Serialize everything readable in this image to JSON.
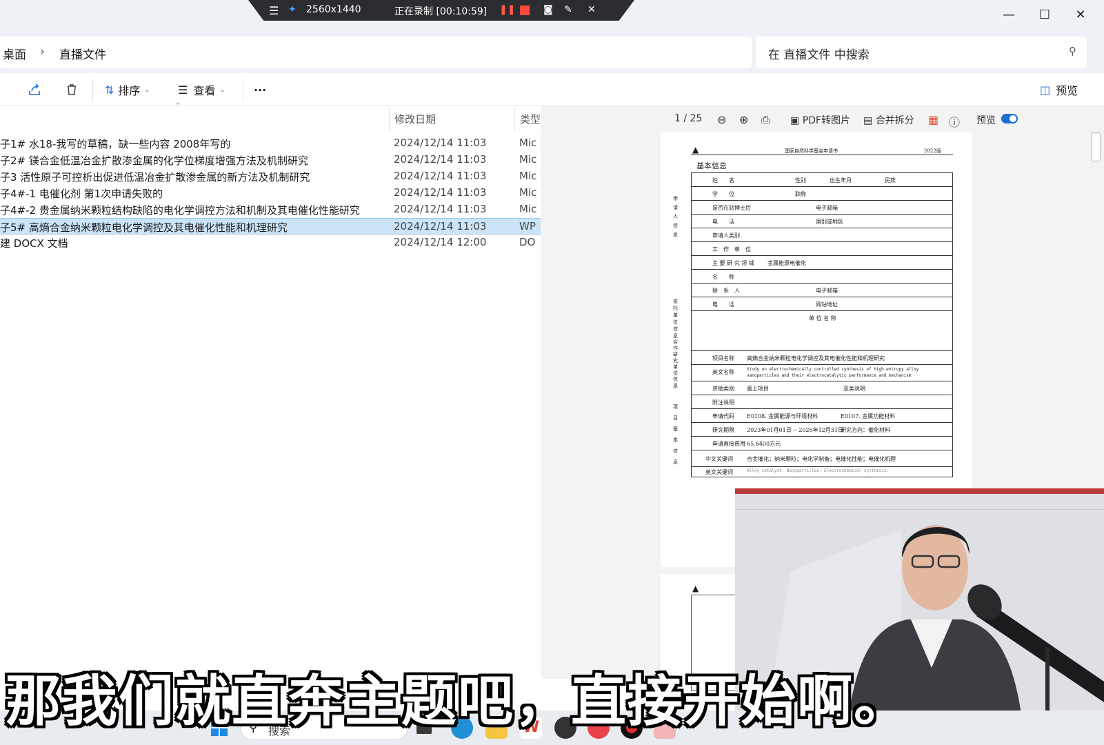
{
  "recorder": {
    "resolution": "2560x1440",
    "status": "正在录制 [00:10:59]"
  },
  "address": {
    "crumbs": [
      "桌面",
      "直播文件"
    ],
    "search_placeholder": "在 直播文件 中搜索"
  },
  "toolbar": {
    "sort_label": "排序",
    "view_label": "查看",
    "more_label": "···",
    "preview_label": "预览"
  },
  "filelist": {
    "columns": {
      "modified": "修改日期",
      "type": "类型"
    },
    "rows": [
      {
        "name": "子1# 水18-我写的草稿，缺一些内容 2008年写的",
        "date": "2024/12/14 11:03",
        "type": "Mic"
      },
      {
        "name": "子2# 镁合金低温冶金扩散渗金属的化学位梯度增强方法及机制研究",
        "date": "2024/12/14 11:03",
        "type": "Mic"
      },
      {
        "name": "子3 活性原子可控析出促进低温冶金扩散渗金属的新方法及机制研究",
        "date": "2024/12/14 11:03",
        "type": "Mic"
      },
      {
        "name": "子4#-1 电催化剂 第1次申请失败的",
        "date": "2024/12/14 11:03",
        "type": "Mic"
      },
      {
        "name": "子4#-2 贵金属纳米颗粒结构缺陷的电化学调控方法和机制及其电催化性能研究",
        "date": "2024/12/14 11:03",
        "type": "Mic"
      },
      {
        "name": "子5# 高熵合金纳米颗粒电化学调控及其电催化性能和机理研究",
        "date": "2024/12/14 11:03",
        "type": "WP"
      },
      {
        "name": "建 DOCX 文档",
        "date": "2024/12/14 12:00",
        "type": "DO"
      }
    ]
  },
  "preview": {
    "page_indicator": "1 / 25",
    "pdf_to_image": "PDF转图片",
    "merge_split": "合并拆分",
    "preview_toggle_label": "预览",
    "doc": {
      "header_center": "国家自然科学基金申请书",
      "header_right": "2022版",
      "section_title": "基本信息",
      "rows": [
        "姓　　名",
        "学　　位",
        "是否在站博士后",
        "电　　话",
        "申请人类别",
        "工　作　单　位",
        "主 要 研 究 领 域",
        "名　　称",
        "联　系　人",
        "电　　话",
        "单 位 名 称",
        "项目名称",
        "英文名称",
        "资助类别",
        "附注说明",
        "申请代码",
        "研究期限",
        "申请直接费用",
        "中文关键词",
        "英文关键词"
      ],
      "cells": {
        "gender": "性别",
        "birth": "出生年月",
        "nation": "民族",
        "title": "职称",
        "email": "电子邮箱",
        "country": "国别或地区",
        "field_value": "金属能源电催化",
        "email2": "电子邮箱",
        "website": "网站地址",
        "project_name": "高熵合金纳米颗粒电化学调控及其电催化性能和机理研究",
        "english_name": "Study on electrochemically controlled synthesis of high-entropy alloy nanoparticles and their electrocatalytic performance and mechanism",
        "funding_type": "面上项目",
        "sub_type": "亚类说明",
        "code1": "E0108. 金属能源与环境材料",
        "code2": "E0107. 金属功能材料",
        "period": "2023年01月01日 -- 2026年12月31日",
        "direction": "研究方向：催化材料",
        "cost": "65.6400万元",
        "cn_keywords": "合金催化；纳米颗粒；电化学制备；电催化性能；电催化机理",
        "en_keywords": "Alloy catalyst; Nanoparticles; Electrochemical synthesis;"
      },
      "side_groups": [
        "申请人信息",
        "依托单位信息",
        "合作研究单位信息",
        "项目基本信息"
      ]
    }
  },
  "taskbar": {
    "search_label": "搜索"
  },
  "subtitle": "那我们就直奔主题吧，直接开始啊。"
}
